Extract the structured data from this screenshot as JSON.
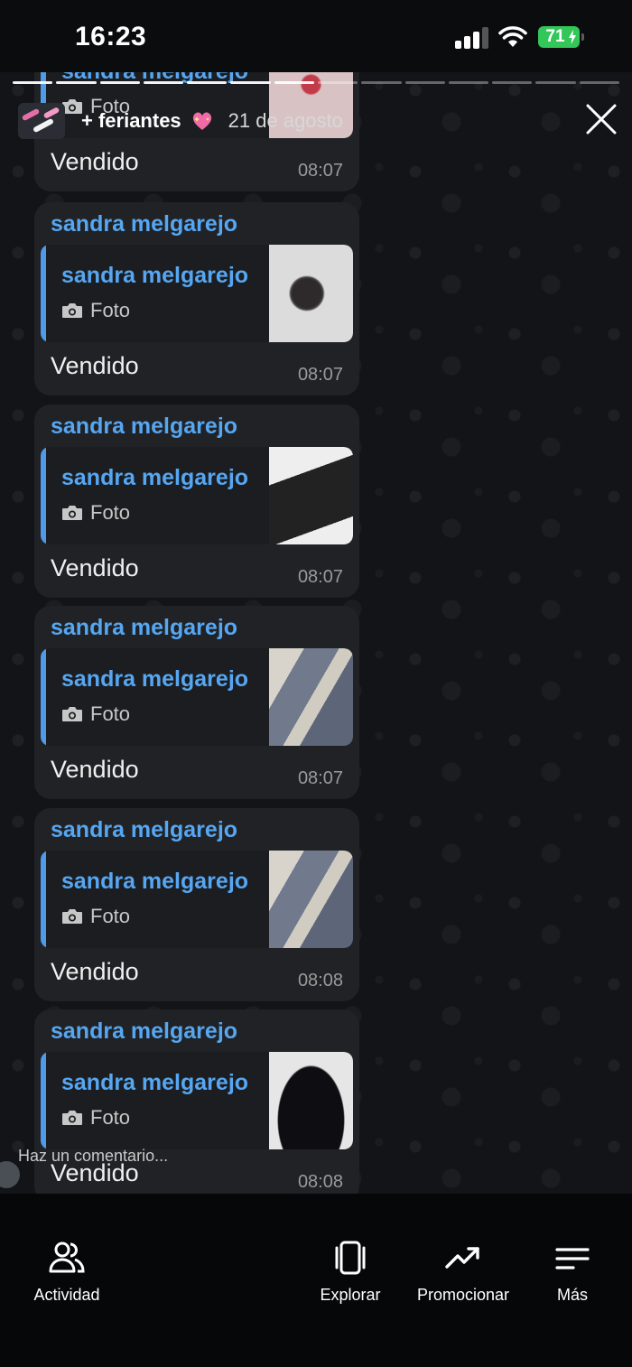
{
  "status_bar": {
    "time": "16:23",
    "battery": "71",
    "signal_bars": 3,
    "signal_total": 4
  },
  "story": {
    "group_name": "+ feriantes",
    "date": "21 de agosto",
    "progress_segments": 14,
    "progress_done": 7,
    "comment_placeholder": "Haz un comentario..."
  },
  "messages": [
    {
      "sender": "sandra melgarejo",
      "quote_sender": "sandra melgarejo",
      "quote_media": "Foto",
      "text": "Vendido",
      "time": "08:07"
    },
    {
      "sender": "sandra melgarejo",
      "quote_sender": "sandra melgarejo",
      "quote_media": "Foto",
      "text": "Vendido",
      "time": "08:07"
    },
    {
      "sender": "sandra melgarejo",
      "quote_sender": "sandra melgarejo",
      "quote_media": "Foto",
      "text": "Vendido",
      "time": "08:07"
    },
    {
      "sender": "sandra melgarejo",
      "quote_sender": "sandra melgarejo",
      "quote_media": "Foto",
      "text": "Vendido",
      "time": "08:07"
    },
    {
      "sender": "sandra melgarejo",
      "quote_sender": "sandra melgarejo",
      "quote_media": "Foto",
      "text": "Vendido",
      "time": "08:08"
    },
    {
      "sender": "sandra melgarejo",
      "quote_sender": "sandra melgarejo",
      "quote_media": "Foto",
      "text": "Vendido",
      "time": "08:08"
    }
  ],
  "bottom_nav": [
    {
      "label": "Actividad",
      "icon": "people-icon"
    },
    {
      "label": "Explorar",
      "icon": "cards-icon"
    },
    {
      "label": "Promocionar",
      "icon": "trend-up-icon"
    },
    {
      "label": "Más",
      "icon": "menu-icon"
    }
  ],
  "colors": {
    "accent": "#56a6f1",
    "bubble": "#202225",
    "battery": "#33c759"
  }
}
